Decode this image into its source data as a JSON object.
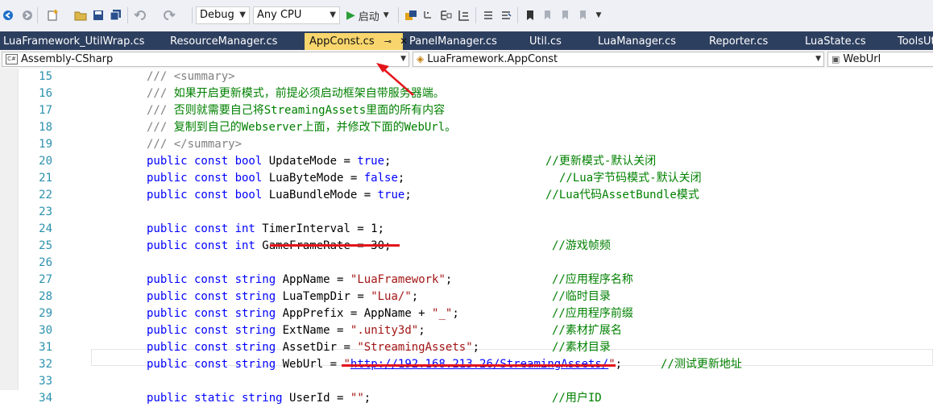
{
  "toolbar": {
    "config": "Debug",
    "platform": "Any CPU",
    "start_label": "启动"
  },
  "tabs": [
    {
      "label": "LuaFramework_UtilWrap.cs"
    },
    {
      "label": "ResourceManager.cs"
    },
    {
      "label": "AppConst.cs",
      "active": true
    },
    {
      "label": "PanelManager.cs"
    },
    {
      "label": "Util.cs"
    },
    {
      "label": "LuaManager.cs"
    },
    {
      "label": "Reporter.cs"
    },
    {
      "label": "LuaState.cs"
    },
    {
      "label": "ToolsUt"
    }
  ],
  "navbar": {
    "project": "Assembly-CSharp",
    "type": "LuaFramework.AppConst",
    "member": "WebUrl",
    "project_icon_text": "C#"
  },
  "colors": {
    "keyword": "#0000ff",
    "string": "#a31515",
    "comment": "#008000",
    "doc_comment": "#808080",
    "line_number": "#2b91af",
    "active_tab": "#f9d66d",
    "tab_bar": "#2d3f5f",
    "annotation": "#e3141b"
  },
  "code_lines": [
    {
      "n": "15",
      "doc": "///",
      "doctag": "<summary>"
    },
    {
      "n": "16",
      "doc": "///",
      "text": "如果开启更新模式，前提必须启动框架自带服务器端。"
    },
    {
      "n": "17",
      "doc": "///",
      "text": "否则就需要自己将StreamingAssets里面的所有内容"
    },
    {
      "n": "18",
      "doc": "///",
      "text": "复制到自己的Webserver上面，并修改下面的WebUrl。"
    },
    {
      "n": "19",
      "doc": "///",
      "doctag": "</summary>"
    },
    {
      "n": "20",
      "kw": "public const bool",
      "name": "UpdateMode",
      "eq": " = ",
      "val_kw": "true",
      "end": ";",
      "comment": "//更新模式-默认关闭"
    },
    {
      "n": "21",
      "kw": "public const bool",
      "name": "LuaByteMode",
      "eq": " = ",
      "val_kw": "false",
      "end": ";",
      "comment": "//Lua字节码模式-默认关闭"
    },
    {
      "n": "22",
      "kw": "public const bool",
      "name": "LuaBundleMode",
      "eq": " = ",
      "val_kw": "true",
      "end": ";",
      "comment": "//Lua代码AssetBundle模式"
    },
    {
      "n": "23"
    },
    {
      "n": "24",
      "kw": "public const int",
      "name": "TimerInterval",
      "eq": " = ",
      "val": "1",
      "end": ";"
    },
    {
      "n": "25",
      "kw": "public const int",
      "name": "GameFrameRate",
      "eq": " = ",
      "val": "30",
      "end": ";",
      "comment": "//游戏帧频"
    },
    {
      "n": "26"
    },
    {
      "n": "27",
      "kw": "public const string",
      "name": "AppName",
      "eq": " = ",
      "str": "\"LuaFramework\"",
      "end": ";",
      "comment": "//应用程序名称"
    },
    {
      "n": "28",
      "kw": "public const string",
      "name": "LuaTempDir",
      "eq": " = ",
      "str": "\"Lua/\"",
      "end": ";",
      "comment": "//临时目录"
    },
    {
      "n": "29",
      "kw": "public const string",
      "name": "AppPrefix",
      "eq": " = ",
      "val": "AppName + ",
      "str": "\"_\"",
      "end": ";",
      "comment": "//应用程序前缀"
    },
    {
      "n": "30",
      "kw": "public const string",
      "name": "ExtName",
      "eq": " = ",
      "str": "\".unity3d\"",
      "end": ";",
      "comment": "//素材扩展名"
    },
    {
      "n": "31",
      "kw": "public const string",
      "name": "AssetDir",
      "eq": " = ",
      "str": "\"StreamingAssets\"",
      "end": ";",
      "comment": "//素材目录"
    },
    {
      "n": "32",
      "kw": "public const string",
      "name": "WebUrl",
      "eq": " = ",
      "str_q": "\"",
      "url": "http://192.168.213.26/StreamingAssets/",
      "str_q2": "\"",
      "end": ";",
      "comment": "//测试更新地址"
    },
    {
      "n": "33"
    },
    {
      "n": "34",
      "kw": "public static string",
      "name": "UserId",
      "eq": " = ",
      "str": "\"\"",
      "end": ";",
      "comment": "//用户ID"
    }
  ]
}
